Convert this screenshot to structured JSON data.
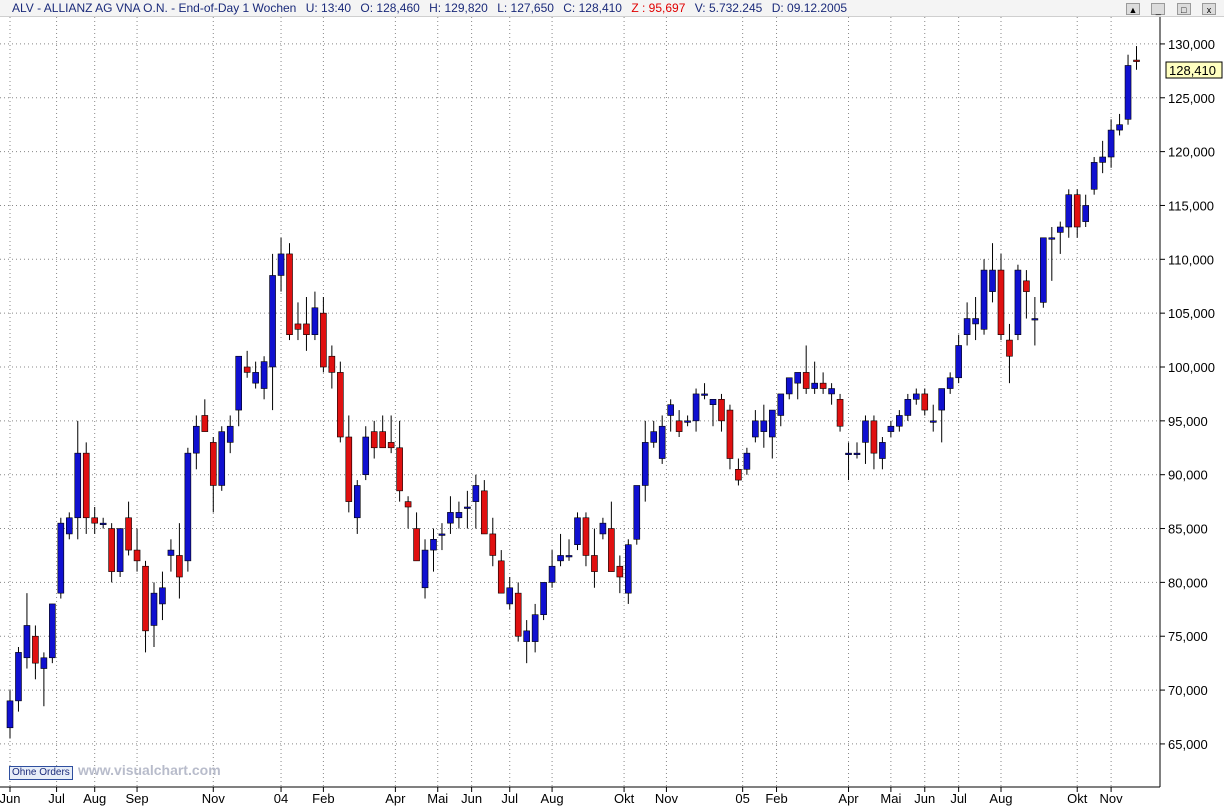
{
  "header": {
    "symbol": "ALV - ALLIANZ AG VNA O.N. - End-of-Day 1 Wochen",
    "time": "U: 13:40",
    "open": "O: 128,460",
    "high": "H: 129,820",
    "low": "L: 127,650",
    "close": "C: 128,410",
    "z": "Z : 95,697",
    "volume": "V: 5.732.245",
    "date": "D: 09.12.2005",
    "text_color": "#1a2a7a",
    "z_color": "#e00000"
  },
  "window_controls": {
    "scroll": "▲",
    "minimize": "_",
    "maximize": "□",
    "close": "x"
  },
  "orders_button": "Ohne Orders",
  "watermark": "www.visualchart.com",
  "price_tag": "128,410",
  "colors": {
    "up": "#1010d0",
    "down": "#e01010",
    "grid": "#888888",
    "tag_bg": "#ffffc0"
  },
  "chart_data": {
    "type": "candlestick",
    "timeframe": "weekly",
    "ylim": [
      61000,
      132500
    ],
    "yticks": [
      "130,000",
      "125,000",
      "120,000",
      "115,000",
      "110,000",
      "105,000",
      "100,000",
      "95,000",
      "90,000",
      "85,000",
      "80,000",
      "75,000",
      "70,000",
      "65,000"
    ],
    "ytick_values": [
      130,
      125,
      120,
      115,
      110,
      105,
      100,
      95,
      90,
      85,
      80,
      75,
      70,
      65
    ],
    "month_labels": [
      {
        "label": "Jun",
        "bar": 0
      },
      {
        "label": "Jul",
        "bar": 5.5
      },
      {
        "label": "Aug",
        "bar": 10
      },
      {
        "label": "Sep",
        "bar": 15
      },
      {
        "label": "Nov",
        "bar": 24
      },
      {
        "label": "04",
        "bar": 32
      },
      {
        "label": "Feb",
        "bar": 37
      },
      {
        "label": "Apr",
        "bar": 45.5
      },
      {
        "label": "Mai",
        "bar": 50.5
      },
      {
        "label": "Jun",
        "bar": 54.5
      },
      {
        "label": "Jul",
        "bar": 59
      },
      {
        "label": "Aug",
        "bar": 64
      },
      {
        "label": "Okt",
        "bar": 72.5
      },
      {
        "label": "Nov",
        "bar": 77.5
      },
      {
        "label": "05",
        "bar": 86.5
      },
      {
        "label": "Feb",
        "bar": 90.5
      },
      {
        "label": "Apr",
        "bar": 99
      },
      {
        "label": "Mai",
        "bar": 104
      },
      {
        "label": "Jun",
        "bar": 108
      },
      {
        "label": "Jul",
        "bar": 112
      },
      {
        "label": "Aug",
        "bar": 117
      },
      {
        "label": "Okt",
        "bar": 126
      },
      {
        "label": "Nov",
        "bar": 130
      }
    ],
    "ohlc": [
      [
        66.5,
        70,
        65.5,
        69
      ],
      [
        69,
        74,
        68,
        73.5
      ],
      [
        73,
        79,
        72,
        76
      ],
      [
        75,
        76,
        71,
        72.5
      ],
      [
        72,
        73.5,
        68.5,
        73
      ],
      [
        73,
        78,
        72.5,
        78
      ],
      [
        79,
        86,
        78.5,
        85.5
      ],
      [
        84.5,
        86.5,
        84,
        86
      ],
      [
        86,
        95,
        84,
        92
      ],
      [
        92,
        93,
        84.5,
        86
      ],
      [
        86,
        87,
        84.5,
        85.5
      ],
      [
        85.5,
        86,
        85,
        85.5
      ],
      [
        85,
        85.5,
        80,
        81
      ],
      [
        81,
        85,
        80.5,
        85
      ],
      [
        86,
        87.5,
        82.5,
        83
      ],
      [
        83,
        85,
        81,
        82
      ],
      [
        81.5,
        82,
        73.5,
        75.5
      ],
      [
        76,
        80,
        74,
        79
      ],
      [
        78,
        81,
        76.5,
        79.5
      ],
      [
        82.5,
        84,
        81,
        83
      ],
      [
        82.5,
        85.5,
        78.5,
        80.5
      ],
      [
        82,
        92.5,
        81,
        92
      ],
      [
        92,
        95.5,
        90.5,
        94.5
      ],
      [
        95.5,
        97,
        94,
        94
      ],
      [
        93,
        93.5,
        86.5,
        89
      ],
      [
        89,
        94.5,
        88.5,
        94
      ],
      [
        93,
        95.5,
        92,
        94.5
      ],
      [
        96,
        100.5,
        94.5,
        101
      ],
      [
        100,
        101.5,
        99,
        99.5
      ],
      [
        98.5,
        100.5,
        98,
        99.5
      ],
      [
        98,
        101,
        97,
        100.5
      ],
      [
        100,
        110.5,
        96,
        108.5
      ],
      [
        108.5,
        112,
        107,
        110.5
      ],
      [
        110.5,
        111.5,
        102.5,
        103
      ],
      [
        104,
        106,
        102.5,
        103.5
      ],
      [
        104,
        106.5,
        101.5,
        103
      ],
      [
        103,
        107,
        102.5,
        105.5
      ],
      [
        105,
        106.5,
        99.5,
        100
      ],
      [
        101,
        102,
        98,
        99.5
      ],
      [
        99.5,
        100.5,
        93,
        93.5
      ],
      [
        93.5,
        95.5,
        86.5,
        87.5
      ],
      [
        86,
        89.5,
        84.5,
        89
      ],
      [
        90,
        94.5,
        89.5,
        93.5
      ],
      [
        94,
        95,
        91.5,
        92.5
      ],
      [
        94,
        95.5,
        92.5,
        92.5
      ],
      [
        93,
        95.5,
        92,
        92.5
      ],
      [
        92.5,
        95,
        87.5,
        88.5
      ],
      [
        87.5,
        88,
        85,
        87
      ],
      [
        85,
        86.5,
        82,
        82
      ],
      [
        79.5,
        84,
        78.5,
        83
      ],
      [
        83,
        85,
        81,
        84
      ],
      [
        84.5,
        85.5,
        83,
        84.5
      ],
      [
        85.5,
        88,
        84.5,
        86.5
      ],
      [
        86,
        87.5,
        85,
        86.5
      ],
      [
        87,
        88.5,
        85,
        87
      ],
      [
        87.5,
        90,
        85,
        89
      ],
      [
        88.5,
        89.5,
        84.5,
        84.5
      ],
      [
        84.5,
        86,
        81.5,
        82.5
      ],
      [
        82,
        83,
        79,
        79
      ],
      [
        78,
        80.5,
        77.5,
        79.5
      ],
      [
        79,
        80,
        74.5,
        75
      ],
      [
        74.5,
        76.5,
        72.5,
        75.5
      ],
      [
        74.5,
        78,
        73.5,
        77
      ],
      [
        77,
        80,
        76.5,
        80
      ],
      [
        80,
        83,
        79.5,
        81.5
      ],
      [
        82,
        84.5,
        81.5,
        82.5
      ],
      [
        82.5,
        84,
        82,
        82.5
      ],
      [
        83.5,
        86.5,
        83,
        86
      ],
      [
        86,
        86.5,
        81.5,
        82.5
      ],
      [
        82.5,
        85,
        79.5,
        81
      ],
      [
        84.5,
        86,
        84,
        85.5
      ],
      [
        85,
        87.5,
        81,
        81
      ],
      [
        81.5,
        82.5,
        79,
        80.5
      ],
      [
        79,
        84,
        78,
        83.5
      ],
      [
        84,
        88.5,
        83.5,
        89
      ],
      [
        89,
        95,
        87.5,
        93
      ],
      [
        93,
        95,
        92.5,
        94
      ],
      [
        91.5,
        95.5,
        91,
        94.5
      ],
      [
        95.5,
        97,
        94,
        96.5
      ],
      [
        95,
        96,
        93.5,
        94
      ],
      [
        95,
        95.5,
        94.5,
        95
      ],
      [
        95,
        98,
        94,
        97.5
      ],
      [
        97.5,
        98.5,
        97,
        97.5
      ],
      [
        96.5,
        97,
        94.5,
        97
      ],
      [
        97,
        97.5,
        94,
        95
      ],
      [
        96,
        96.5,
        90.5,
        91.5
      ],
      [
        90.5,
        91.5,
        89,
        89.5
      ],
      [
        90.5,
        92.5,
        90,
        92
      ],
      [
        93.5,
        96,
        93,
        95
      ],
      [
        94,
        96.5,
        92.5,
        95
      ],
      [
        93.5,
        96,
        91.5,
        96
      ],
      [
        95.5,
        97,
        94.5,
        97.5
      ],
      [
        97.5,
        99,
        97,
        99
      ],
      [
        98.5,
        99,
        97,
        99.5
      ],
      [
        99.5,
        102,
        97.5,
        98
      ],
      [
        98,
        100.5,
        97.5,
        98.5
      ],
      [
        98.5,
        99.5,
        97.5,
        98
      ],
      [
        97.5,
        98.5,
        96.5,
        98
      ],
      [
        97,
        97.5,
        94,
        94.5
      ],
      [
        92,
        93,
        89.5,
        92
      ],
      [
        92,
        93,
        91.5,
        92
      ],
      [
        93,
        95.5,
        91,
        95
      ],
      [
        95,
        95.5,
        90.5,
        92
      ],
      [
        91.5,
        93.5,
        90.5,
        93
      ],
      [
        94,
        95,
        93.5,
        94.5
      ],
      [
        94.5,
        96,
        94,
        95.5
      ],
      [
        95.5,
        97.5,
        95,
        97
      ],
      [
        97,
        98,
        96.5,
        97.5
      ],
      [
        97.5,
        98,
        95.5,
        96
      ],
      [
        95,
        96.5,
        94,
        95
      ],
      [
        96,
        98,
        93,
        98
      ],
      [
        98,
        99.5,
        97.5,
        99
      ],
      [
        99,
        103,
        98.5,
        102
      ],
      [
        103,
        106,
        102,
        104.5
      ],
      [
        104,
        106.5,
        102.5,
        104.5
      ],
      [
        103.5,
        110,
        103,
        109
      ],
      [
        107,
        111.5,
        106,
        109
      ],
      [
        109,
        110.5,
        102.5,
        103
      ],
      [
        102.5,
        104,
        98.5,
        101
      ],
      [
        103,
        109.5,
        102.5,
        109
      ],
      [
        108,
        109,
        104.5,
        107
      ],
      [
        104.5,
        106.5,
        102,
        104.5
      ],
      [
        106,
        110,
        105.5,
        112
      ],
      [
        112,
        113,
        108,
        112
      ],
      [
        112.5,
        113.5,
        110.5,
        113
      ],
      [
        113,
        116.5,
        112,
        116
      ],
      [
        116,
        116.5,
        112,
        113
      ],
      [
        113.5,
        116,
        113,
        115
      ],
      [
        116.5,
        119.5,
        116,
        119
      ],
      [
        119,
        121,
        118,
        119.5
      ],
      [
        119.5,
        123,
        118.5,
        122
      ],
      [
        122,
        123.5,
        121.5,
        122.5
      ],
      [
        123,
        129,
        122.5,
        128
      ],
      [
        128.5,
        129.8,
        127.6,
        128.41
      ]
    ]
  }
}
